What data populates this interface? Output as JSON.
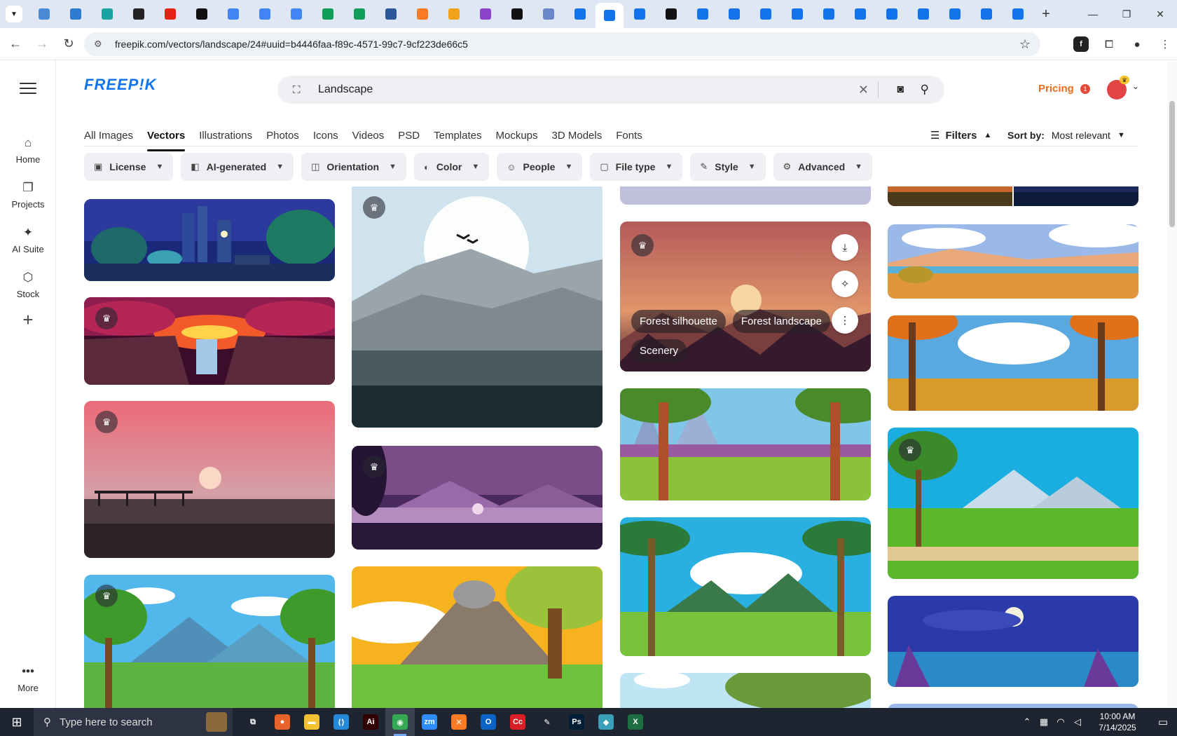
{
  "browser": {
    "url": "freepik.com/vectors/landscape/24#uuid=b4446faa-f89c-4571-99c7-9cf223de66c5",
    "tab_favicons": [
      {
        "icon": "globe-blue-icon",
        "color": "#4b8bd6"
      },
      {
        "icon": "shield-icon",
        "color": "#2e7bcf"
      },
      {
        "icon": "diamond-icon",
        "color": "#1aa3a3"
      },
      {
        "icon": "openai-icon",
        "color": "#222222"
      },
      {
        "icon": "youtube-icon",
        "color": "#e62117"
      },
      {
        "icon": "bolt-icon",
        "color": "#111111"
      },
      {
        "icon": "docs-icon",
        "color": "#4285f4"
      },
      {
        "icon": "docs-icon",
        "color": "#4285f4"
      },
      {
        "icon": "docs-icon",
        "color": "#4285f4"
      },
      {
        "icon": "sheets-icon",
        "color": "#0f9d58"
      },
      {
        "icon": "sheets-icon",
        "color": "#0f9d58"
      },
      {
        "icon": "word-icon",
        "color": "#2b579a"
      },
      {
        "icon": "xampp-icon",
        "color": "#fb7a24"
      },
      {
        "icon": "crown-icon",
        "color": "#f2a31b"
      },
      {
        "icon": "braces-icon",
        "color": "#8b44c9"
      },
      {
        "icon": "a-logo-icon",
        "color": "#111111"
      },
      {
        "icon": "grid-icon",
        "color": "#6a88c8"
      },
      {
        "icon": "freepik-icon",
        "color": "#1273eb"
      },
      {
        "icon": "freepik-icon",
        "color": "#1273eb"
      },
      {
        "icon": "freepik-icon",
        "color": "#1273eb"
      },
      {
        "icon": "m-logo-icon",
        "color": "#111111"
      },
      {
        "icon": "freepik-icon",
        "color": "#1273eb"
      },
      {
        "icon": "freepik-icon",
        "color": "#1273eb"
      },
      {
        "icon": "freepik-icon",
        "color": "#1273eb"
      },
      {
        "icon": "freepik-icon",
        "color": "#1273eb"
      },
      {
        "icon": "freepik-icon",
        "color": "#1273eb"
      },
      {
        "icon": "freepik-icon",
        "color": "#1273eb"
      },
      {
        "icon": "freepik-icon",
        "color": "#1273eb"
      },
      {
        "icon": "freepik-icon",
        "color": "#1273eb"
      },
      {
        "icon": "freepik-icon",
        "color": "#1273eb"
      },
      {
        "icon": "freepik-icon",
        "color": "#1273eb"
      },
      {
        "icon": "freepik-icon",
        "color": "#1273eb"
      }
    ],
    "active_tab_index": 18,
    "new_tab": "+",
    "window_controls": [
      "—",
      "❐",
      "✕"
    ]
  },
  "freepik": {
    "logo": "FREEP!K",
    "search_value": "Landscape",
    "pricing": "Pricing",
    "notification_count": "1",
    "left_nav": [
      {
        "label": "Home",
        "icon": "home-icon",
        "glyph": "⌂"
      },
      {
        "label": "Projects",
        "icon": "projects-icon",
        "glyph": "❐"
      },
      {
        "label": "AI Suite",
        "icon": "sparkle-icon",
        "glyph": "✦"
      },
      {
        "label": "Stock",
        "icon": "stock-icon",
        "glyph": "⬡"
      }
    ],
    "more_label": "More",
    "categories": [
      "All Images",
      "Vectors",
      "Illustrations",
      "Photos",
      "Icons",
      "Videos",
      "PSD",
      "Templates",
      "Mockups",
      "3D Models",
      "Fonts"
    ],
    "active_category": "Vectors",
    "filters_label": "Filters",
    "sort_label": "Sort by:",
    "sort_value": "Most relevant",
    "filter_chips": [
      {
        "label": "License",
        "icon": "license-icon"
      },
      {
        "label": "AI-generated",
        "icon": "ai-icon"
      },
      {
        "label": "Orientation",
        "icon": "orientation-icon"
      },
      {
        "label": "Color",
        "icon": "palette-icon"
      },
      {
        "label": "People",
        "icon": "people-icon"
      },
      {
        "label": "File type",
        "icon": "file-icon"
      },
      {
        "label": "Style",
        "icon": "brush-icon"
      },
      {
        "label": "Advanced",
        "icon": "gear-icon"
      }
    ],
    "hovered_card_tags": [
      "Forest silhouette",
      "Forest landscape",
      "Scenery"
    ]
  },
  "taskbar": {
    "search_placeholder": "Type here to search",
    "time": "10:00 AM",
    "date": "7/14/2025",
    "apps": [
      {
        "icon": "task-view-icon",
        "color": "#1e2430",
        "glyph": "⧉"
      },
      {
        "icon": "firefox-icon",
        "color": "#e8632a",
        "glyph": "●"
      },
      {
        "icon": "file-explorer-icon",
        "color": "#f2c230",
        "glyph": "▬"
      },
      {
        "icon": "vscode-icon",
        "color": "#2389d8",
        "glyph": "⟨⟩"
      },
      {
        "icon": "illustrator-icon",
        "color": "#330000",
        "glyph": "Ai"
      },
      {
        "icon": "chrome-icon",
        "color": "#34a853",
        "glyph": "◉"
      },
      {
        "icon": "zoom-icon",
        "color": "#2d8cff",
        "glyph": "zm"
      },
      {
        "icon": "xampp-icon",
        "color": "#fb7a24",
        "glyph": "✕"
      },
      {
        "icon": "outlook-icon",
        "color": "#0a64c8",
        "glyph": "O"
      },
      {
        "icon": "creative-cloud-icon",
        "color": "#da1f26",
        "glyph": "Cc"
      },
      {
        "icon": "pen-icon",
        "color": "#1e2430",
        "glyph": "✎"
      },
      {
        "icon": "photoshop-icon",
        "color": "#001e36",
        "glyph": "Ps"
      },
      {
        "icon": "gem-icon",
        "color": "#3aa0b8",
        "glyph": "◆"
      },
      {
        "icon": "excel-icon",
        "color": "#1d6f42",
        "glyph": "X"
      }
    ],
    "active_app_index": 5
  }
}
